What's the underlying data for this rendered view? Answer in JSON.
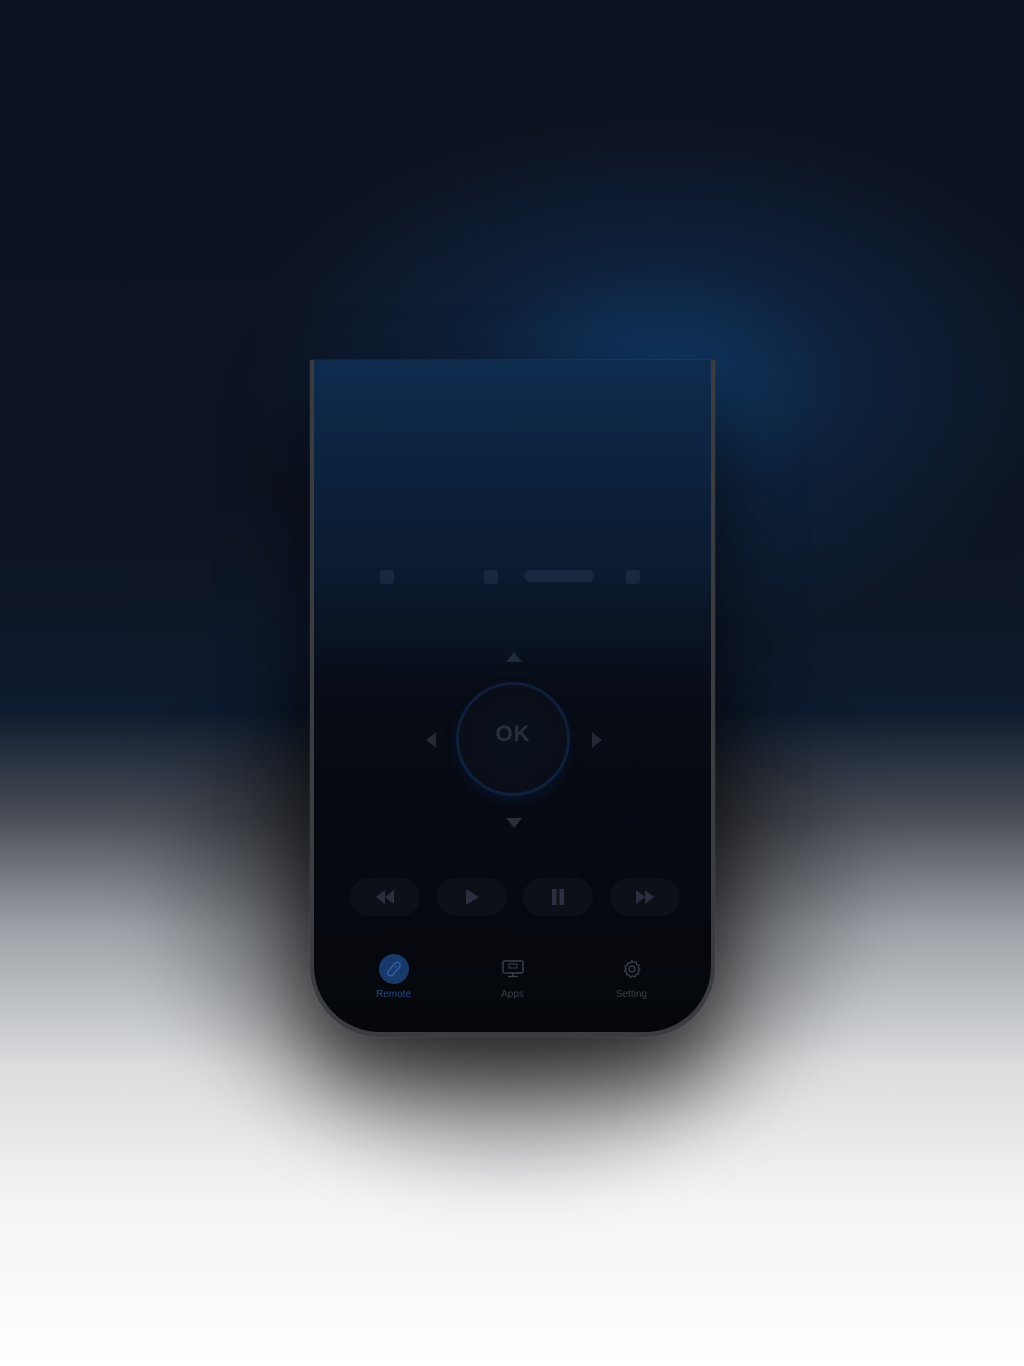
{
  "dpad": {
    "ok_label": "OK"
  },
  "media": [
    {
      "icon": "rewind-icon"
    },
    {
      "icon": "play-icon"
    },
    {
      "icon": "pause-icon"
    },
    {
      "icon": "fast-forward-icon"
    }
  ],
  "tabs": [
    {
      "label": "Remote",
      "icon": "remote-icon",
      "active": true
    },
    {
      "label": "Apps",
      "icon": "apps-icon",
      "active": false
    },
    {
      "label": "Setting",
      "icon": "gear-icon",
      "active": false
    }
  ],
  "colors": {
    "accent": "#1f4c86",
    "background_top": "#0d1220",
    "glow": "#103a69"
  }
}
